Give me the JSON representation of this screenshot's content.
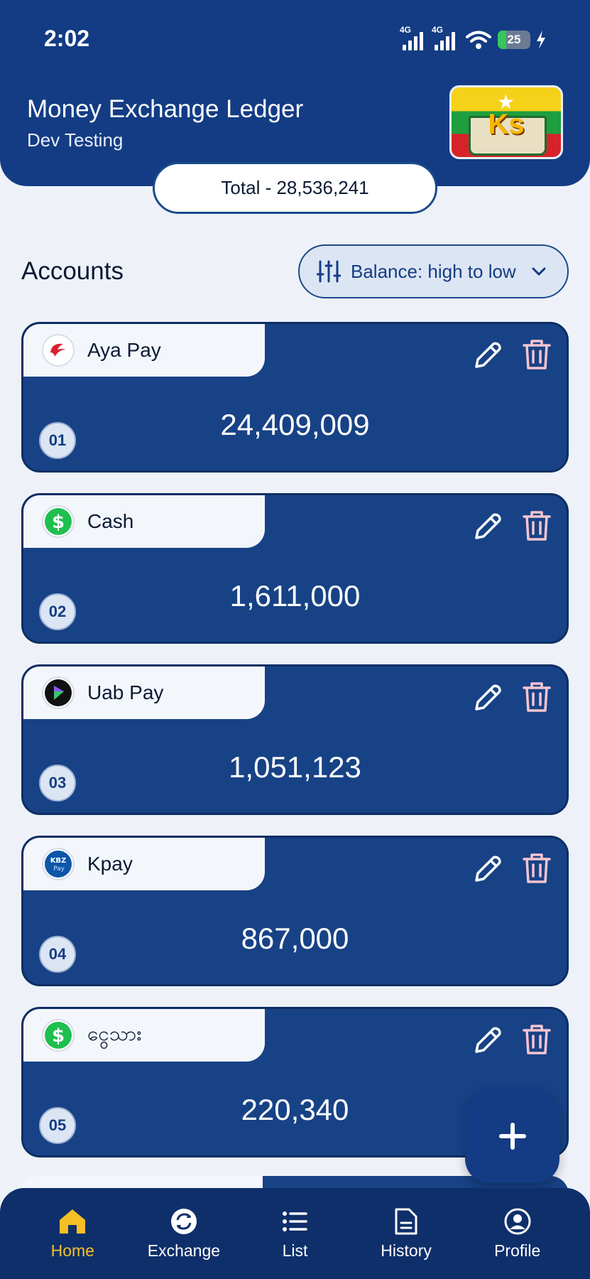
{
  "status_bar": {
    "time": "2:02",
    "network_1": "4G",
    "network_2": "4G",
    "battery_percent": 25
  },
  "header": {
    "title": "Money Exchange Ledger",
    "subtitle": "Dev Testing",
    "logo_text": "Ks",
    "total": "Total - 28,536,241"
  },
  "accounts": {
    "title": "Accounts",
    "sort_label": "Balance: high to low",
    "items": [
      {
        "name": "Aya Pay",
        "amount": "24,409,009",
        "index": "01",
        "icon": "aya-pay-icon"
      },
      {
        "name": "Cash",
        "amount": "1,611,000",
        "index": "02",
        "icon": "dollar-icon"
      },
      {
        "name": "Uab Pay",
        "amount": "1,051,123",
        "index": "03",
        "icon": "uab-pay-icon"
      },
      {
        "name": "Kpay",
        "amount": "867,000",
        "index": "04",
        "icon": "kbz-pay-icon",
        "icon_text_1": "KBZ",
        "icon_text_2": "Pay"
      },
      {
        "name": "ငွေသား",
        "amount": "220,340",
        "index": "05",
        "icon": "dollar-icon"
      }
    ]
  },
  "nav": {
    "items": [
      {
        "label": "Home",
        "icon": "home-icon",
        "active": true
      },
      {
        "label": "Exchange",
        "icon": "exchange-icon",
        "active": false
      },
      {
        "label": "List",
        "icon": "list-icon",
        "active": false
      },
      {
        "label": "History",
        "icon": "document-icon",
        "active": false
      },
      {
        "label": "Profile",
        "icon": "profile-icon",
        "active": false
      }
    ]
  },
  "colors": {
    "primary": "#133c84",
    "card": "#174286",
    "accent_active": "#f5c026",
    "delete": "#f6c4d0",
    "background": "#eef2f8"
  }
}
